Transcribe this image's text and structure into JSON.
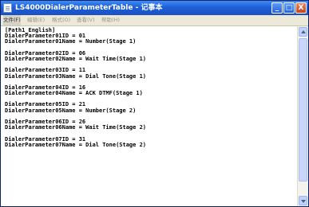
{
  "window": {
    "title": "LS4000DialerParameterTable - 记事本",
    "minimize_glyph": "_",
    "maximize_glyph": "□",
    "close_glyph": "X"
  },
  "menu": [
    "文件(F)",
    "编辑(E)",
    "格式(O)",
    "查看(V)",
    "帮助(H)"
  ],
  "lines": [
    "[Path1_English]",
    "DialerParameter01ID = 01",
    "DialerParameter01Name = Number(Stage 1)",
    "",
    "DialerParameter02ID = 06",
    "DialerParameter02Name = Wait Time(Stage 1)",
    "",
    "DialerParameter03ID = 11",
    "DialerParameter03Name = Dial Tone(Stage 1)",
    "",
    "DialerParameter04ID = 16",
    "DialerParameter04Name = ACK DTMF(Stage 1)",
    "",
    "DialerParameter05ID = 21",
    "DialerParameter05Name = Number(Stage 2)",
    "",
    "DialerParameter06ID = 26",
    "DialerParameter06Name = Wait Time(Stage 2)",
    "",
    "DialerParameter07ID = 31",
    "DialerParameter07Name = Dial Tone(Stage 2)",
    ""
  ],
  "colors": {
    "titlebar": "#1e5fd6",
    "close_button": "#c2451c",
    "text": "#000000"
  },
  "icons": [
    "notepad-icon",
    "minimize-icon",
    "maximize-icon",
    "close-icon",
    "scroll-up-icon",
    "scroll-down-icon"
  ]
}
